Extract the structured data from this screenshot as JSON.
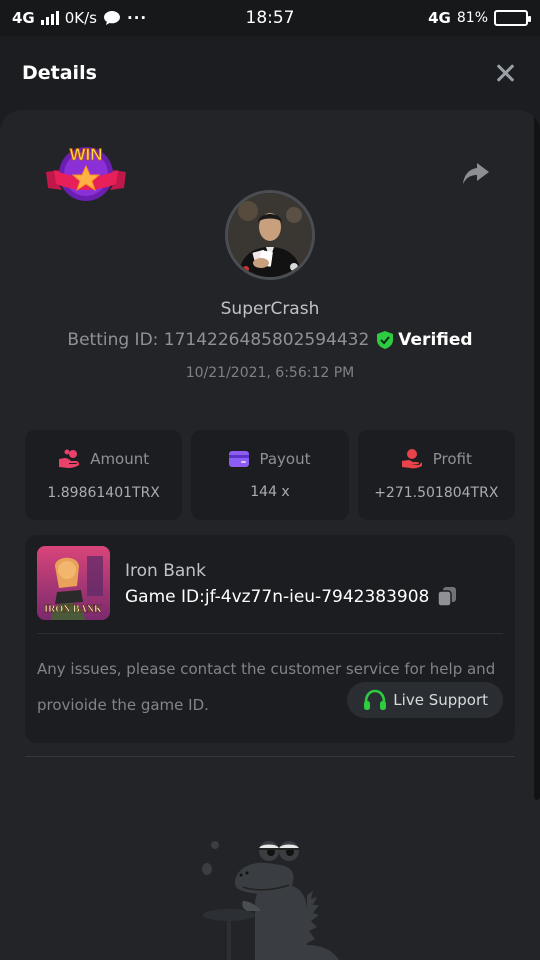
{
  "status_bar": {
    "network": "4G",
    "speed": "0K/s",
    "more": "···",
    "time": "18:57",
    "network2": "4G",
    "battery_percent": "81%",
    "battery_level": 0.81
  },
  "header": {
    "title": "Details",
    "close_icon": "close-icon"
  },
  "bet": {
    "badge_text": "WIN",
    "username": "SuperCrash",
    "betting_id": "Betting ID: 1714226485802594432",
    "verified_label": "Verified",
    "timestamp": "10/21/2021, 6:56:12 PM"
  },
  "stats": [
    {
      "label": "Amount",
      "value": "1.89861401TRX",
      "icon": "coins-hand-icon",
      "color": "#e8426a"
    },
    {
      "label": "Payout",
      "value": "144 x",
      "icon": "wallet-card-icon",
      "color": "#8b5cf6"
    },
    {
      "label": "Profit",
      "value": "+271.501804TRX",
      "icon": "hand-profit-icon",
      "color": "#e8424a"
    }
  ],
  "game": {
    "name": "Iron Bank",
    "game_id": "Game ID:jf-4vz77n-ieu-7942383908",
    "thumb_title": "IRON BANK",
    "help_text": "Any issues, please contact the customer service for help and provioide the game ID.",
    "support_label": "Live Support"
  },
  "colors": {
    "accent_green": "#2ecc40",
    "background": "#1b1d20",
    "sheet": "#222427"
  }
}
